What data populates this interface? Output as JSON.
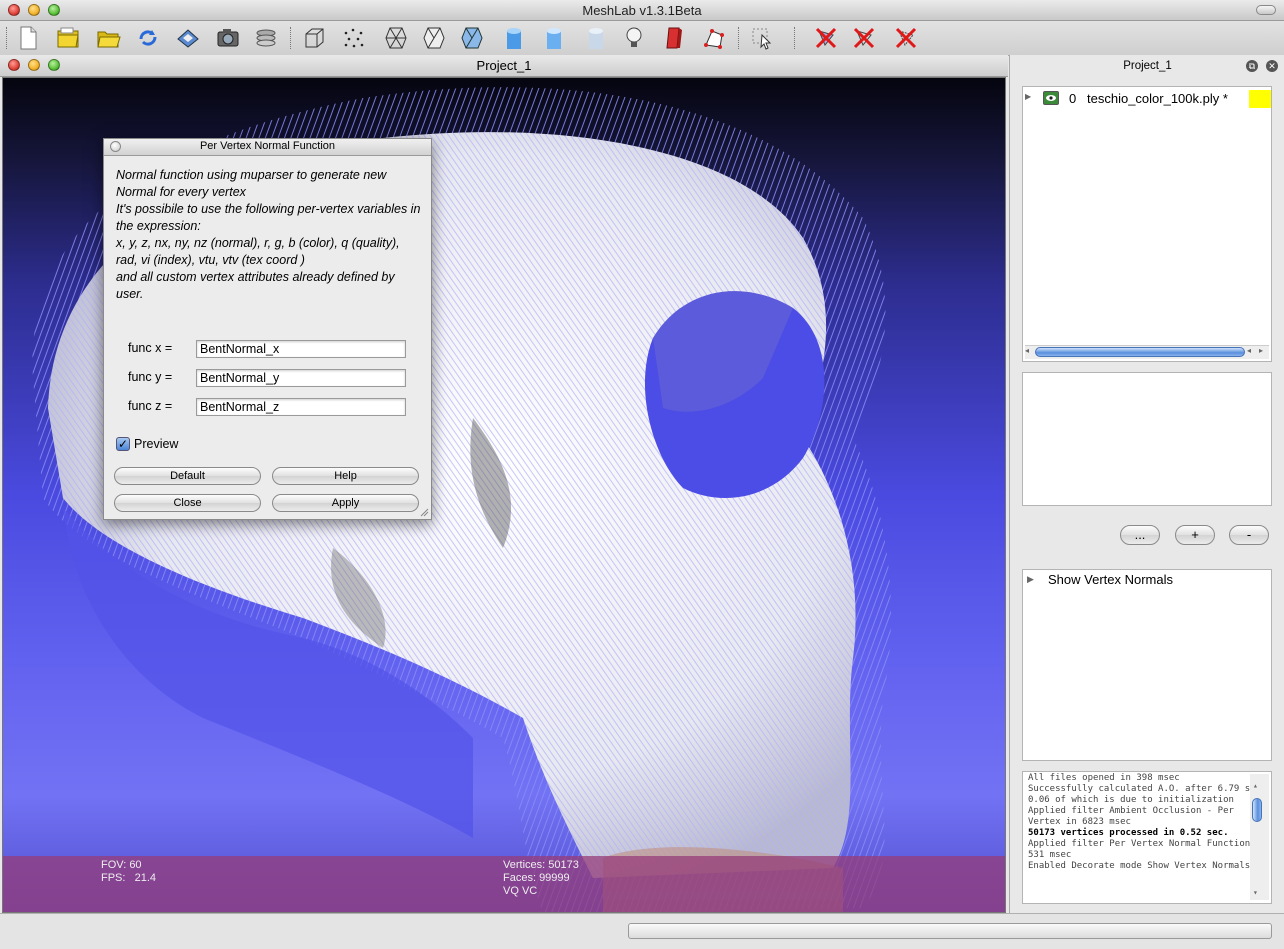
{
  "app": {
    "title": "MeshLab v1.3.1Beta"
  },
  "toolbar": {
    "icons": [
      "new-document-icon",
      "open-project-icon",
      "open-file-icon",
      "reload-icon",
      "save-icon",
      "snapshot-icon",
      "layers-icon",
      "bbox-icon",
      "points-icon",
      "wireframe-icon",
      "hidden-lines-icon",
      "flat-lines-icon",
      "flat-icon",
      "smooth-icon",
      "texture-icon",
      "light-bulb-icon",
      "backface-icon",
      "select-vertex-icon",
      "select-arrow-icon",
      "delete-faces-icon",
      "delete-vertices-icon",
      "delete-all-icon"
    ]
  },
  "project": {
    "title": "Project_1"
  },
  "viewport": {
    "fov_label": "FOV: 60",
    "fps_label": "FPS:   21.4",
    "vertices_label": "Vertices: 50173",
    "faces_label": "Faces: 99999",
    "mode_label": "VQ VC"
  },
  "dialog": {
    "title": "Per Vertex Normal Function",
    "description": "Normal function using muparser to generate new Normal for every vertex\nIt's possibile to use the following per-vertex variables in the expression:\nx, y, z, nx, ny, nz (normal), r, g, b (color), q (quality), rad, vi (index), vtu, vtv (tex coord )\nand all custom vertex attributes already defined by user.",
    "fields": [
      {
        "label": "func x =",
        "value": "BentNormal_x"
      },
      {
        "label": "func y =",
        "value": "BentNormal_y"
      },
      {
        "label": "func z =",
        "value": "BentNormal_z"
      }
    ],
    "preview_label": "Preview",
    "preview_checked": true,
    "buttons": {
      "default": "Default",
      "help": "Help",
      "close": "Close",
      "apply": "Apply"
    }
  },
  "dock": {
    "title": "Project_1",
    "layer": {
      "index": "0",
      "name": "teschio_color_100k.ply *",
      "color": "#ffff00"
    },
    "buttons": {
      "more": "...",
      "plus": "+",
      "minus": "-"
    },
    "decorator": "Show Vertex Normals",
    "log": [
      {
        "text": "All files opened in 398 msec",
        "bold": false
      },
      {
        "text": "Successfully calculated A.O. after 6.79 sec, 0.06 of which is due to initialization",
        "bold": false
      },
      {
        "text": "Applied filter Ambient Occlusion - Per Vertex in 6823 msec",
        "bold": false
      },
      {
        "text": "50173 vertices processed in 0.52 sec.",
        "bold": true
      },
      {
        "text": "Applied filter Per Vertex Normal Function in 531 msec",
        "bold": false
      },
      {
        "text": "Enabled Decorate mode Show Vertex Normals",
        "bold": false
      }
    ]
  }
}
